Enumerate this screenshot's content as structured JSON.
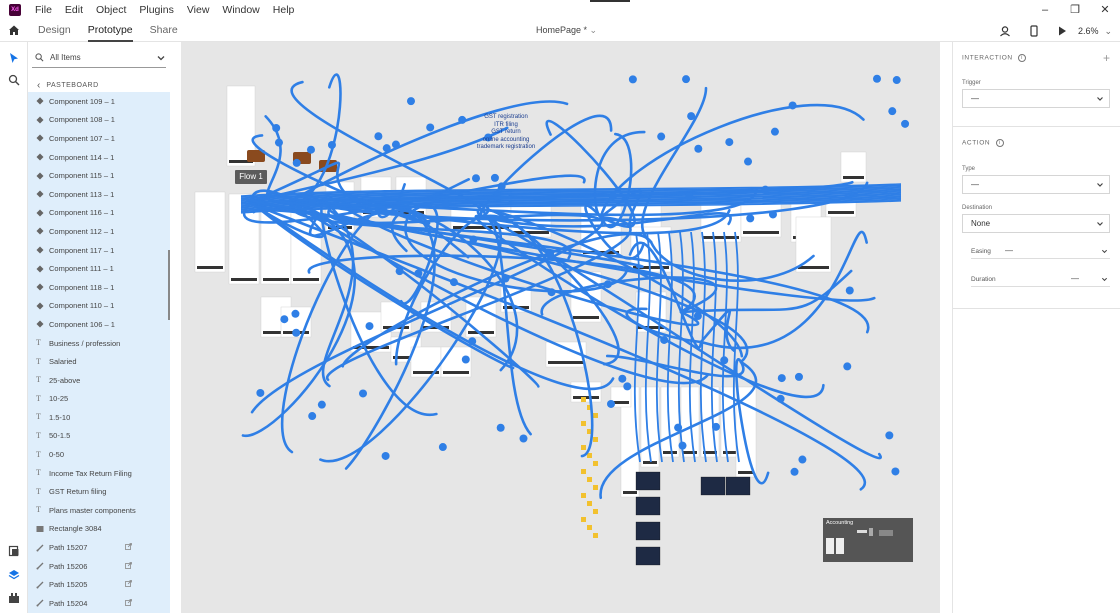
{
  "titlebar": {
    "app_logo": "Xd",
    "menu": [
      "File",
      "Edit",
      "Object",
      "Plugins",
      "View",
      "Window",
      "Help"
    ],
    "window_controls": [
      "minimize-icon",
      "restore-icon",
      "close-icon"
    ]
  },
  "appbar": {
    "tabs": [
      "Design",
      "Prototype",
      "Share"
    ],
    "active_tab": "Prototype",
    "document_title": "HomePage *",
    "zoom": "2.6%"
  },
  "layers": {
    "search_placeholder": "All Items",
    "pasteboard_label": "PASTEBOARD",
    "items": [
      {
        "label": "Component 109 – 1",
        "icon": "component-icon"
      },
      {
        "label": "Component 108 – 1",
        "icon": "component-icon"
      },
      {
        "label": "Component 107 – 1",
        "icon": "component-icon"
      },
      {
        "label": "Component 114 – 1",
        "icon": "component-icon"
      },
      {
        "label": "Component 115 – 1",
        "icon": "component-icon"
      },
      {
        "label": "Component 113 – 1",
        "icon": "component-icon"
      },
      {
        "label": "Component 116 – 1",
        "icon": "component-icon"
      },
      {
        "label": "Component 112 – 1",
        "icon": "component-icon"
      },
      {
        "label": "Component 117 – 1",
        "icon": "component-icon"
      },
      {
        "label": "Component 111 – 1",
        "icon": "component-icon"
      },
      {
        "label": "Component 118 – 1",
        "icon": "component-icon"
      },
      {
        "label": "Component 110 – 1",
        "icon": "component-icon"
      },
      {
        "label": "Component 106 – 1",
        "icon": "component-icon"
      },
      {
        "label": "Business / profession",
        "icon": "text-icon"
      },
      {
        "label": "Salaried",
        "icon": "text-icon"
      },
      {
        "label": "25-above",
        "icon": "text-icon"
      },
      {
        "label": "10-25",
        "icon": "text-icon"
      },
      {
        "label": "1.5-10",
        "icon": "text-icon"
      },
      {
        "label": "50-1.5",
        "icon": "text-icon"
      },
      {
        "label": "0-50",
        "icon": "text-icon"
      },
      {
        "label": "Income Tax Return Filing",
        "icon": "text-icon"
      },
      {
        "label": "GST Return filing",
        "icon": "text-icon"
      },
      {
        "label": "Plans master components",
        "icon": "text-icon"
      },
      {
        "label": "Rectangle 3084",
        "icon": "rectangle-icon"
      },
      {
        "label": "Path 15207",
        "icon": "path-icon"
      },
      {
        "label": "Path 15206",
        "icon": "path-icon"
      },
      {
        "label": "Path 15205",
        "icon": "path-icon"
      },
      {
        "label": "Path 15204",
        "icon": "path-icon"
      }
    ]
  },
  "canvas": {
    "flow_label": "Flow 1",
    "note_lines": [
      "GST registration",
      "ITR filing",
      "GST return",
      "online accounting",
      "trademark registration"
    ],
    "accounting_label": "Accounting",
    "wire_color": "#2f7fe6"
  },
  "interaction_panel": {
    "interaction_title": "INTERACTION",
    "trigger_label": "Trigger",
    "trigger_value": "—",
    "action_title": "ACTION",
    "type_label": "Type",
    "type_value": "—",
    "destination_label": "Destination",
    "destination_value": "None",
    "easing_label": "Easing",
    "easing_value": "—",
    "duration_label": "Duration",
    "duration_value": "—"
  }
}
